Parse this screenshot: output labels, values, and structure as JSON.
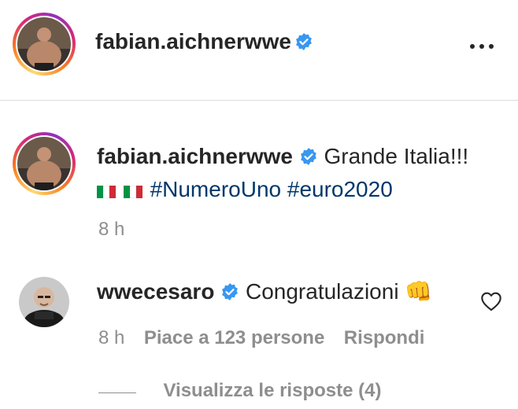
{
  "header": {
    "username": "fabian.aichnerwwe",
    "more_icon": "more-horizontal-icon"
  },
  "post": {
    "username": "fabian.aichnerwwe",
    "caption_text": "Grande Italia!!!",
    "flags": [
      "italy-flag",
      "italy-flag"
    ],
    "hashtags": [
      "#NumeroUno",
      "#euro2020"
    ],
    "time": "8 h"
  },
  "comment": {
    "username": "wwecesaro",
    "text": "Congratulazioni",
    "emoji": "👊",
    "time": "8 h",
    "likes": "Piace a 123 persone",
    "reply": "Rispondi",
    "view_replies": "Visualizza le risposte (4)"
  },
  "colors": {
    "verified": "#3897f0",
    "hashtag": "#00376b",
    "muted": "#8e8e8e"
  }
}
